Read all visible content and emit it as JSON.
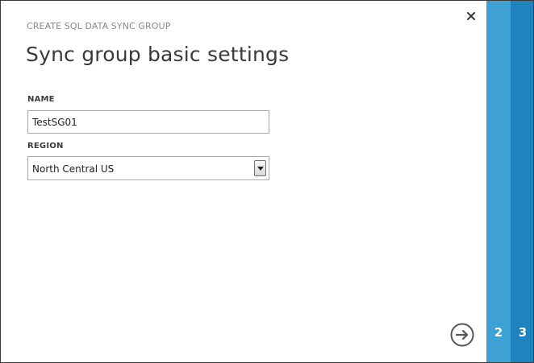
{
  "dialog": {
    "subtitle": "CREATE SQL DATA SYNC GROUP",
    "title": "Sync group basic settings"
  },
  "form": {
    "name_label": "NAME",
    "name_value": "TestSG01",
    "region_label": "REGION",
    "region_value": "North Central US"
  },
  "icons": {
    "close": "close-icon",
    "next": "arrow-right-circle-icon",
    "dropdown": "chevron-down-icon"
  },
  "steps": [
    {
      "label": "2"
    },
    {
      "label": "3"
    }
  ],
  "colors": {
    "step2": "#3fa0d3",
    "step3": "#1f83bf",
    "accent_text": "#3a3a3a"
  }
}
